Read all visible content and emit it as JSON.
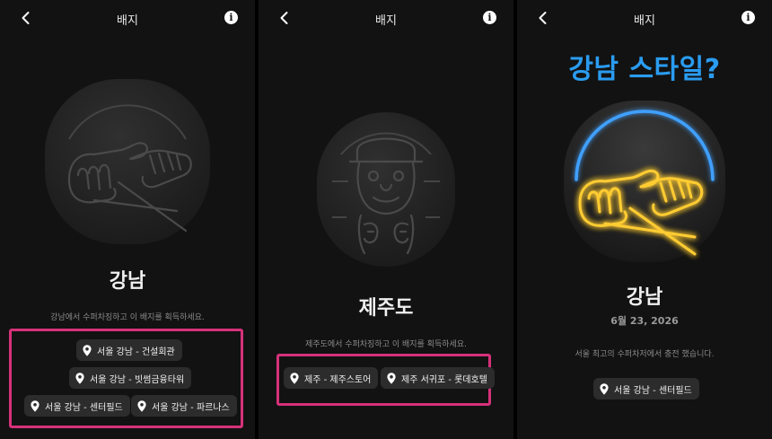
{
  "screens": [
    {
      "title": "배지",
      "badge_name": "강남",
      "description": "강남에서 수퍼차징하고 이 배지를 획득하세요.",
      "locations": [
        "서울 강남 - 건설회관",
        "서울 강남 - 빗썸금융타워",
        "서울 강남 - 센터필드",
        "서울 강남 - 파르나스"
      ]
    },
    {
      "title": "배지",
      "badge_name": "제주도",
      "description": "제주도에서 수퍼차징하고 이 배지를 획득하세요.",
      "locations": [
        "제주 - 제주스토어",
        "제주 서귀포 - 롯데호텔"
      ]
    },
    {
      "title": "배지",
      "headline": "강남 스타일?",
      "badge_name": "강남",
      "date": "6월 23, 2026",
      "description": "서울 최고의 수퍼차저에서 충전 했습니다.",
      "locations": [
        "서울 강남 - 센터필드"
      ]
    }
  ],
  "icons": {
    "back": "chevron-left-icon",
    "info": "info-icon",
    "location": "map-pin-icon"
  },
  "colors": {
    "background": "#121212",
    "chip": "#2c2c2c",
    "highlight": "#d6317a",
    "headline": "#2a9cf0",
    "neon_yellow": "#ffcc33",
    "neon_blue": "#3fa0ff"
  },
  "info_glyph": "i"
}
